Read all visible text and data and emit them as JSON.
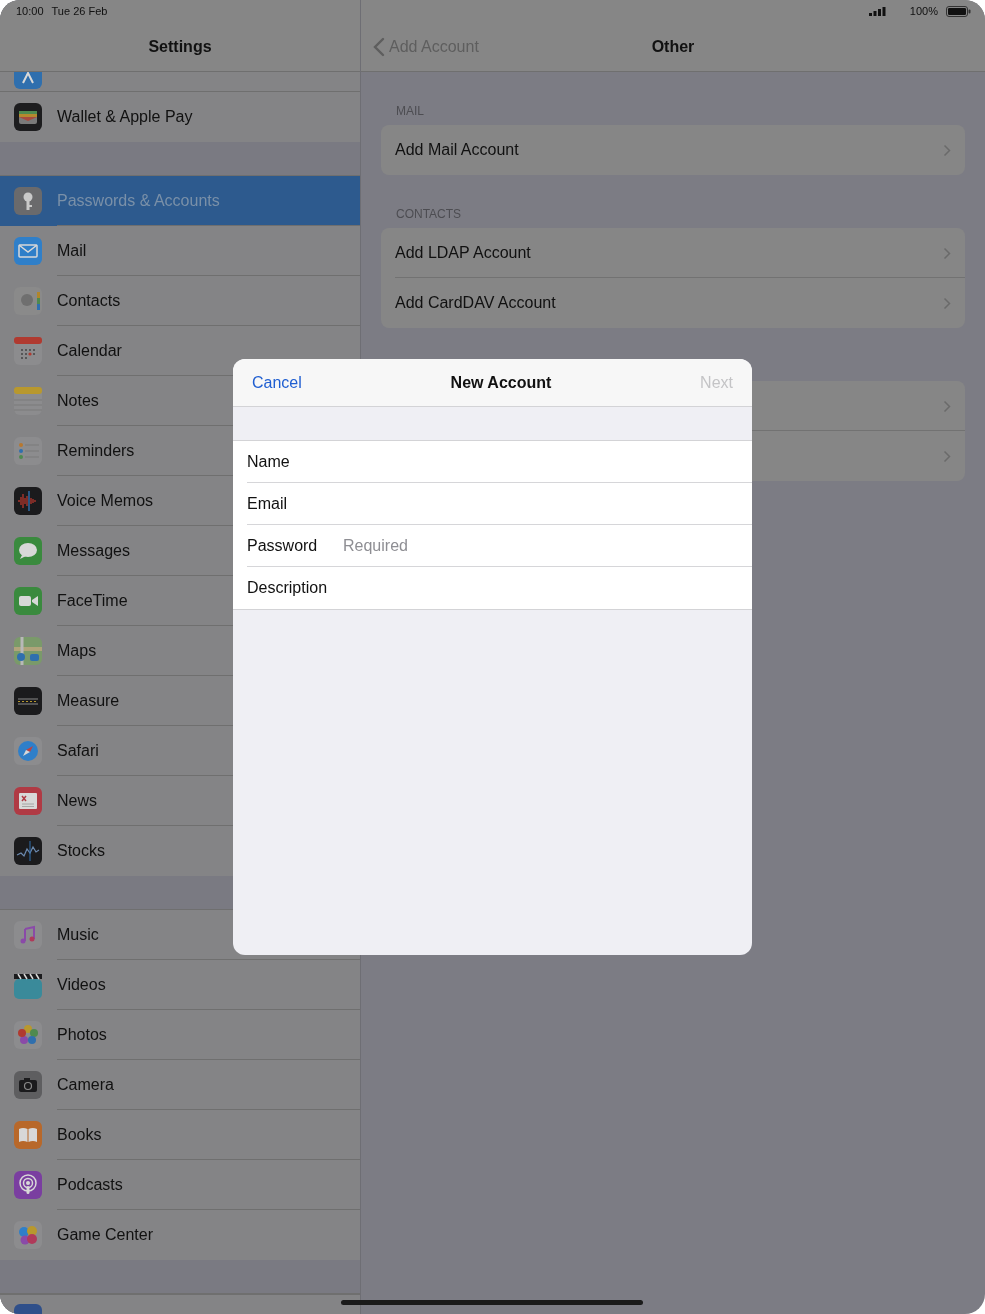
{
  "status_bar": {
    "time": "10:00",
    "date": "Tue 26 Feb",
    "battery": "100%"
  },
  "sidebar": {
    "title": "Settings",
    "groups": [
      {
        "items": [
          {
            "label": "Wallet & Apple Pay",
            "selected": false
          }
        ]
      },
      {
        "items": [
          {
            "label": "Passwords & Accounts",
            "selected": true
          },
          {
            "label": "Mail",
            "selected": false
          },
          {
            "label": "Contacts",
            "selected": false
          },
          {
            "label": "Calendar",
            "selected": false
          },
          {
            "label": "Notes",
            "selected": false
          },
          {
            "label": "Reminders",
            "selected": false
          },
          {
            "label": "Voice Memos",
            "selected": false
          },
          {
            "label": "Messages",
            "selected": false
          },
          {
            "label": "FaceTime",
            "selected": false
          },
          {
            "label": "Maps",
            "selected": false
          },
          {
            "label": "Measure",
            "selected": false
          },
          {
            "label": "Safari",
            "selected": false
          },
          {
            "label": "News",
            "selected": false
          },
          {
            "label": "Stocks",
            "selected": false
          }
        ]
      },
      {
        "items": [
          {
            "label": "Music",
            "selected": false
          },
          {
            "label": "Videos",
            "selected": false
          },
          {
            "label": "Photos",
            "selected": false
          },
          {
            "label": "Camera",
            "selected": false
          },
          {
            "label": "Books",
            "selected": false
          },
          {
            "label": "Podcasts",
            "selected": false
          },
          {
            "label": "Game Center",
            "selected": false
          }
        ]
      }
    ]
  },
  "detail": {
    "back": "Add Account",
    "title": "Other",
    "sections": [
      {
        "header": "MAIL",
        "rows": [
          "Add Mail Account"
        ]
      },
      {
        "header": "CONTACTS",
        "rows": [
          "Add LDAP Account",
          "Add CardDAV Account"
        ]
      }
    ]
  },
  "modal": {
    "cancel": "Cancel",
    "title": "New Account",
    "next": {
      "label": "Next",
      "disabled": true
    },
    "fields": [
      {
        "label": "Name"
      },
      {
        "label": "Email"
      },
      {
        "label": "Password",
        "placeholder": "Required"
      },
      {
        "label": "Description"
      }
    ]
  }
}
